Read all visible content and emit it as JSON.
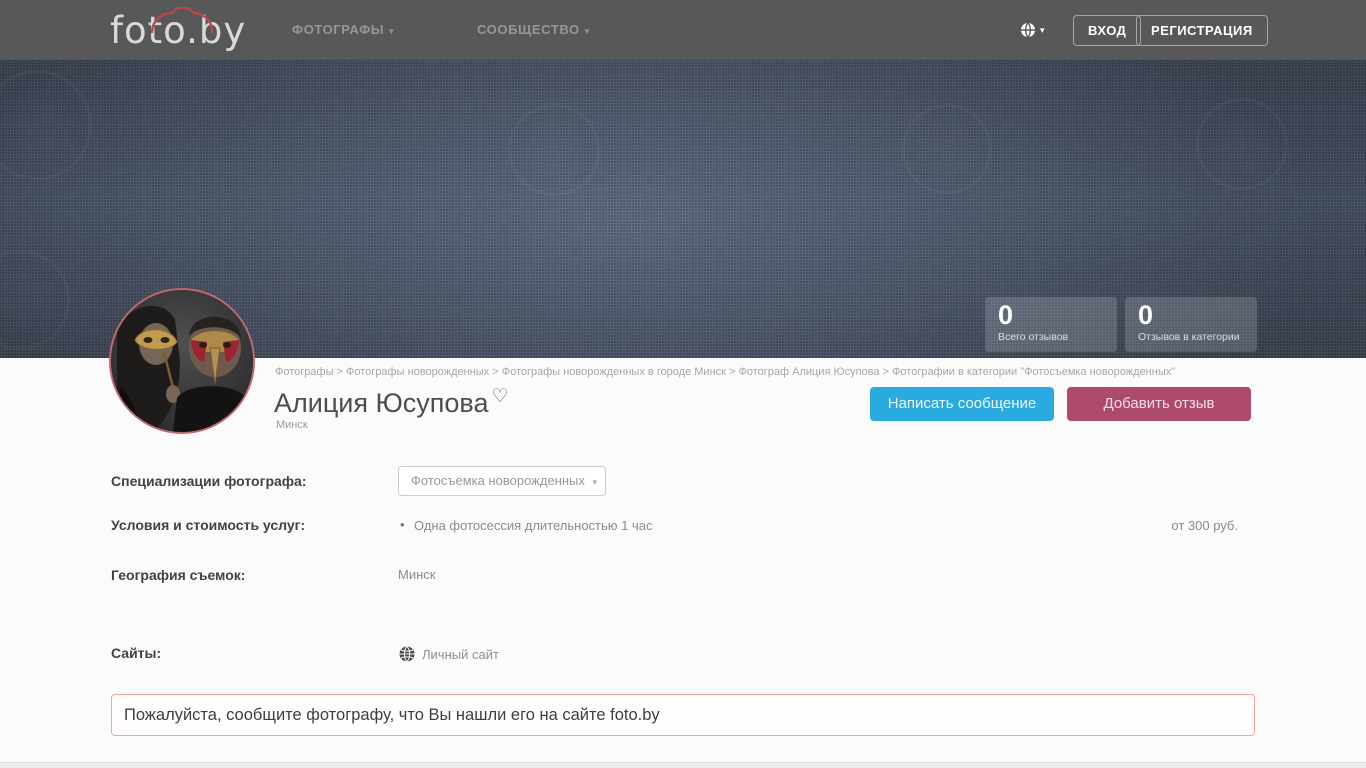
{
  "navbar": {
    "logo": "foto.by",
    "menu": [
      {
        "label": "ФОТОГРАФЫ"
      },
      {
        "label": "СООБЩЕСТВО"
      }
    ],
    "login_label": "ВХОД",
    "register_label": "РЕГИСТРАЦИЯ"
  },
  "hero": {
    "stats": [
      {
        "value": "0",
        "label": "Всего отзывов"
      },
      {
        "value": "0",
        "label": "Отзывов в категории"
      }
    ]
  },
  "breadcrumb": {
    "separator": " > ",
    "items": [
      "Фотографы",
      "Фотографы новорожденных",
      "Фотографы новорожденных в городе Минск",
      "Фотограф Алиция Юсупова",
      "Фотографии в категории \"Фотосъемка новорожденных\""
    ]
  },
  "profile": {
    "name": "Алиция Юсупова",
    "city": "Минск",
    "message_button": "Написать сообщение",
    "review_button": "Добавить отзыв"
  },
  "details": {
    "specializations_label": "Специализации фотографа:",
    "specializations_value": "Фотосъемка новорожденных",
    "pricing_label": "Условия и стоимость услуг:",
    "pricing_item": "Одна фотосессия длительностью 1 час",
    "pricing_value": "от 300 руб.",
    "geography_label": "География съемок:",
    "geography_value": "Минск",
    "sites_label": "Сайты:",
    "sites_value": "Личный сайт"
  },
  "alert": {
    "text": "Пожалуйста, сообщите фотографу, что Вы нашли его на сайте foto.by"
  },
  "glyphs": {
    "caret": "▾",
    "heart": "♡",
    "bullet": "•"
  },
  "colors": {
    "navbar_bg": "#58585a",
    "hero_bg": "#414b5b",
    "message_button": "#29abe2",
    "review_button": "#ae4a69",
    "alert_border": "#f2a4a4",
    "logo_accent": "#b5494c",
    "avatar_ring": "#c2686e"
  }
}
